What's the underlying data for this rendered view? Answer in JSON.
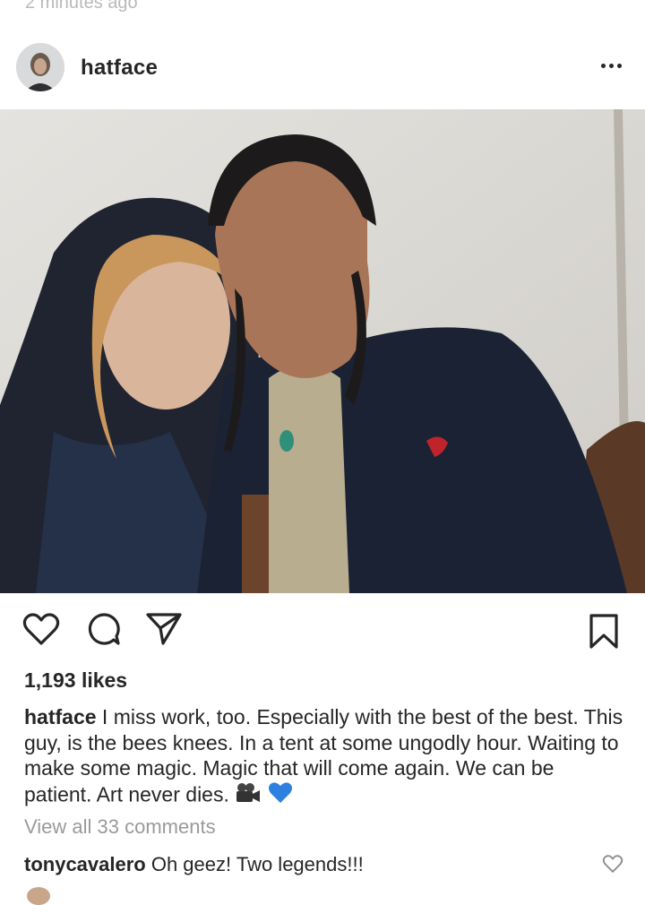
{
  "top_cut_text": "2 minutes ago",
  "post": {
    "username": "hatface",
    "more_icon": "more-horizontal-icon"
  },
  "actions": {
    "like_icon": "heart-outline-icon",
    "comment_icon": "comment-bubble-icon",
    "share_icon": "paper-plane-icon",
    "save_icon": "bookmark-outline-icon"
  },
  "likes": "1,193 likes",
  "caption": {
    "username": "hatface",
    "text": " I miss work, too. Especially with the best of the best. This guy, is the bees knees. In a tent at some ungodly hour. Waiting to make some magic. Magic that will come again. We can be patient. Art never dies.",
    "emojis": [
      "movie-camera-emoji",
      "blue-heart-emoji"
    ]
  },
  "view_all_comments": "View all 33 comments",
  "comments": [
    {
      "username": "tonycavalero",
      "text": " Oh geez! Two legends!!!"
    }
  ]
}
